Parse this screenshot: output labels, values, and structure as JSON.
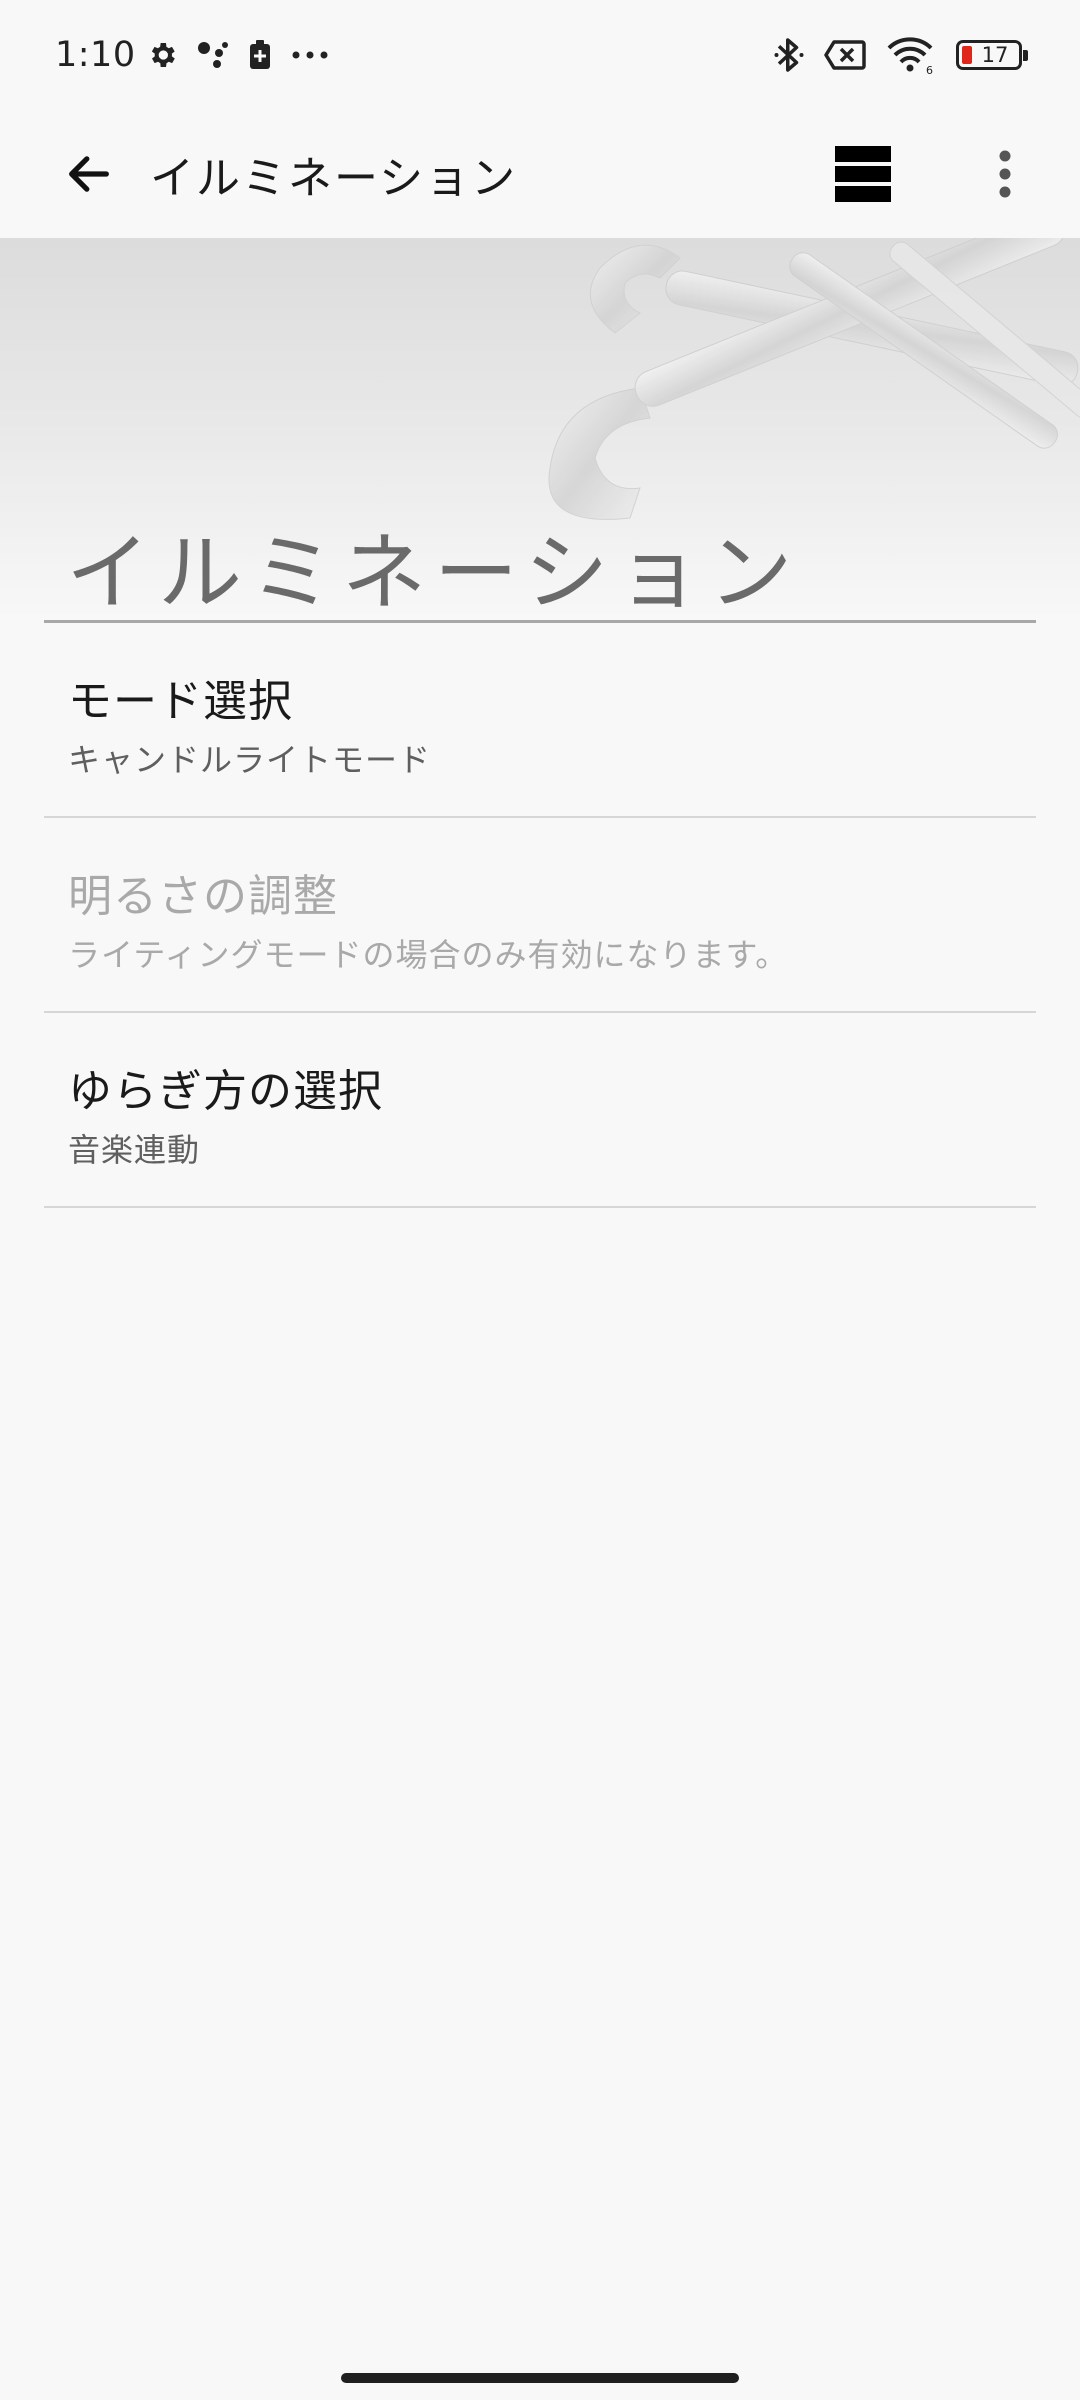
{
  "status_bar": {
    "time": "1:10",
    "battery_level": "17",
    "icons": [
      "settings-gear-icon",
      "assistant-dots-icon",
      "battery-saver-icon",
      "more-notifications-icon",
      "bluetooth-icon",
      "no-sim-icon",
      "wifi-6-icon",
      "battery-icon"
    ]
  },
  "app_bar": {
    "title": "イルミネーション",
    "back_icon": "arrow-left-icon",
    "grid_icon": "layout-grid-icon",
    "more_icon": "more-vert-icon"
  },
  "banner": {
    "title": "イルミネーション"
  },
  "preferences": [
    {
      "title": "モード選択",
      "summary": "キャンドルライトモード",
      "enabled": true
    },
    {
      "title": "明るさの調整",
      "summary": "ライティングモードの場合のみ有効になります。",
      "enabled": false
    },
    {
      "title": "ゆらぎ方の選択",
      "summary": "音楽連動",
      "enabled": true
    }
  ],
  "colors": {
    "background": "#f8f8f8",
    "battery_low": "#e0261b",
    "divider": "#d6d6d6",
    "disabled_text": "#a9a9a9"
  }
}
